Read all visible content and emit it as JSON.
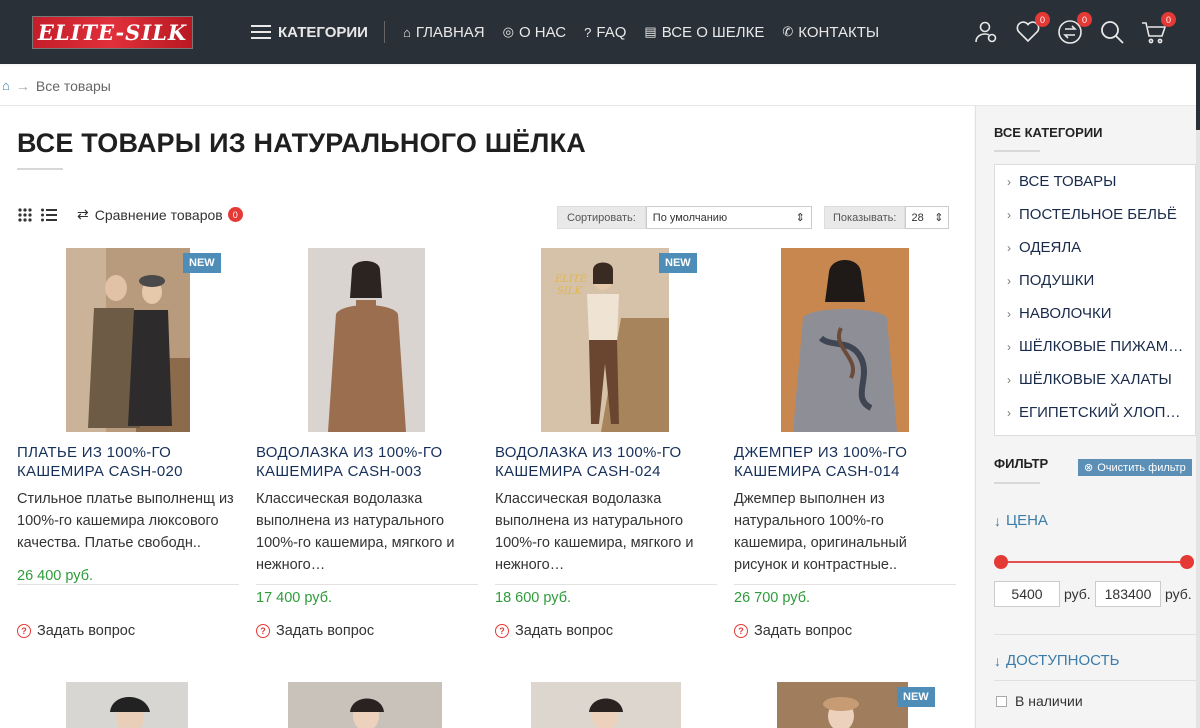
{
  "header": {
    "logo": "ELITE-SILK",
    "nav": [
      {
        "label": "КАТЕГОРИИ",
        "icon": "hamburger-icon"
      },
      {
        "label": "ГЛАВНАЯ",
        "icon": "home-icon"
      },
      {
        "label": "О НАС",
        "icon": "compass-icon"
      },
      {
        "label": "FAQ",
        "icon": "question-icon"
      },
      {
        "label": "ВСЕ О ШЕЛКЕ",
        "icon": "chat-icon"
      },
      {
        "label": "КОНТАКТЫ",
        "icon": "phone-icon"
      }
    ],
    "tools": [
      {
        "icon": "user-icon",
        "badge": ""
      },
      {
        "icon": "heart-icon",
        "badge": "0"
      },
      {
        "icon": "compare-icon",
        "badge": "0"
      },
      {
        "icon": "search-icon",
        "badge": ""
      },
      {
        "icon": "cart-icon",
        "badge": "0"
      }
    ]
  },
  "breadcrumb": {
    "current": "Все товары"
  },
  "page": {
    "title": "ВСЕ ТОВАРЫ ИЗ НАТУРАЛЬНОГО ШЁЛКА"
  },
  "toolbar": {
    "compare_label": "Сравнение товаров",
    "compare_count": "0",
    "sort_label": "Сортировать:",
    "sort_value": "По умолчанию",
    "show_label": "Показывать:",
    "show_value": "28"
  },
  "products": [
    {
      "title": "ПЛАТЬЕ ИЗ 100%-ГО КАШЕМИРА CASH-020",
      "desc": "Стильное платье выполненщ из 100%-го кашемира люксового качества. Платье свободн..",
      "price": "26 400 руб.",
      "badge": "NEW",
      "ask": "Задать вопрос"
    },
    {
      "title": "ВОДОЛАЗКА ИЗ 100%-ГО КАШЕМИРА CASH-003",
      "desc": "Классическая водолазка выполнена из натурального 100%-го кашемира, мягкого и нежного…",
      "price": "17 400 руб.",
      "badge": "",
      "ask": "Задать вопрос"
    },
    {
      "title": "ВОДОЛАЗКА ИЗ 100%-ГО КАШЕМИРА CASH-024",
      "desc": "Классическая водолазка выполнена из натурального 100%-го кашемира, мягкого и нежного…",
      "price": "18 600 руб.",
      "badge": "NEW",
      "ask": "Задать вопрос"
    },
    {
      "title": "ДЖЕМПЕР ИЗ 100%-ГО КАШЕМИРА CASH-014",
      "desc": "Джемпер выполнен из натурального 100%-го кашемира, оригинальный рисунок и контрастные..",
      "price": "26 700 руб.",
      "badge": "",
      "ask": "Задать вопрос"
    }
  ],
  "next_row_badge": "NEW",
  "sidebar": {
    "categories_title": "ВСЕ КАТЕГОРИИ",
    "categories": [
      "ВСЕ ТОВАРЫ",
      "ПОСТЕЛЬНОЕ БЕЛЬЁ",
      "ОДЕЯЛА",
      "ПОДУШКИ",
      "НАВОЛОЧКИ",
      "ШЁЛКОВЫЕ ПИЖАМ…",
      "ШЁЛКОВЫЕ ХАЛАТЫ",
      "ЕГИПЕТСКИЙ ХЛОП…"
    ],
    "filter_title": "ФИЛЬТР",
    "clear_filter": "Очистить фильтр",
    "price_title": "ЦЕНА",
    "price_min": "5400",
    "price_max": "183400",
    "currency": "руб.",
    "availability_title": "ДОСТУПНОСТЬ",
    "in_stock": "В наличии"
  }
}
